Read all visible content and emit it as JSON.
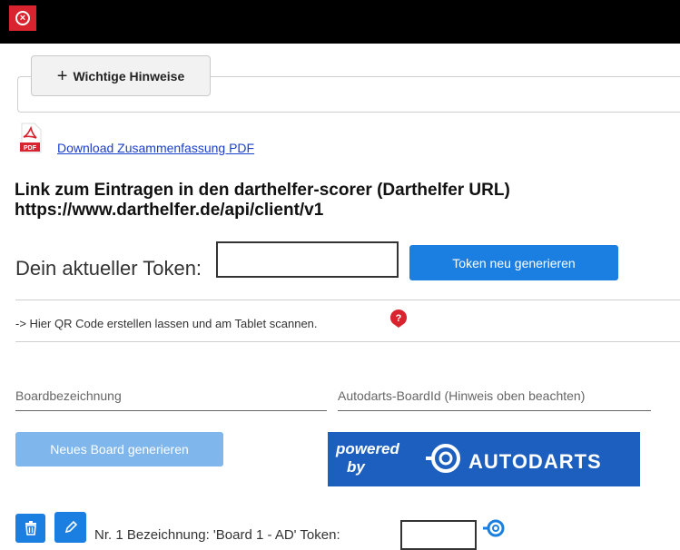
{
  "topbar": {
    "close_icon": "close-circle-icon"
  },
  "hints": {
    "button_label": "Wichtige Hinweise",
    "icon": "plus-icon"
  },
  "download": {
    "icon": "pdf-file-icon",
    "link_text": "Download Zusammenfassung PDF"
  },
  "heading": {
    "line1": "Link zum Eintragen in den darthelfer-scorer (Darthelfer URL)",
    "line2": "https://www.darthelfer.de/api/client/v1"
  },
  "token": {
    "label": "Dein aktueller Token:",
    "value": "",
    "regenerate_label": "Token neu generieren"
  },
  "qr": {
    "text": "-> Hier QR Code erstellen lassen und am Tablet scannen.",
    "icon": "question-marker-icon"
  },
  "board_form": {
    "name_placeholder": "Boardbezeichnung",
    "autodarts_placeholder": "Autodarts-BoardId (Hinweis oben beachten)",
    "generate_label": "Neues Board generieren"
  },
  "banner": {
    "powered": "powered",
    "by": "by",
    "brand": "AUTODARTS"
  },
  "boards": [
    {
      "text": "Nr. 1  Bezeichnung: 'Board 1 - AD' Token:",
      "token": ""
    }
  ],
  "colors": {
    "primary": "#1a7fe0",
    "primary_disabled": "#7fb6ec",
    "danger": "#d9232e",
    "banner": "#1d5fbf"
  }
}
